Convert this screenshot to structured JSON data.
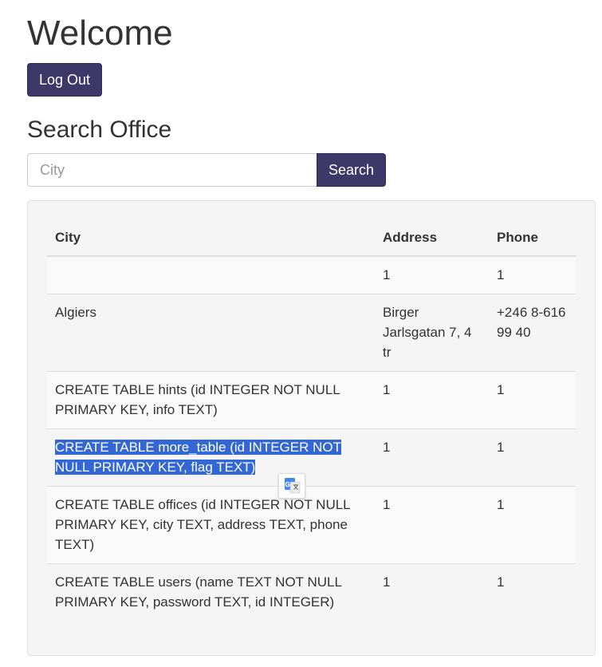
{
  "header": {
    "title": "Welcome",
    "logout_label": "Log Out"
  },
  "search": {
    "heading": "Search Office",
    "placeholder": "City",
    "value": "",
    "button_label": "Search"
  },
  "table": {
    "columns": [
      "City",
      "Address",
      "Phone"
    ],
    "rows": [
      {
        "city": "",
        "address": "1",
        "phone": "1"
      },
      {
        "city": "Algiers",
        "address": "Birger Jarlsgatan 7, 4 tr",
        "phone": "+246 8-616 99 40"
      },
      {
        "city": "CREATE TABLE hints (id INTEGER NOT NULL PRIMARY KEY, info TEXT)",
        "address": "1",
        "phone": "1"
      },
      {
        "city": "CREATE TABLE more_table (id INTEGER NOT NULL PRIMARY KEY, flag TEXT)",
        "address": "1",
        "phone": "1"
      },
      {
        "city": "CREATE TABLE offices (id INTEGER NOT NULL PRIMARY KEY, city TEXT, address TEXT, phone TEXT)",
        "address": "1",
        "phone": "1"
      },
      {
        "city": "CREATE TABLE users (name TEXT NOT NULL PRIMARY KEY, password TEXT, id INTEGER)",
        "address": "1",
        "phone": "1"
      }
    ]
  },
  "overlay": {
    "translate_icon": "google-translate-icon"
  },
  "colors": {
    "primary": "#3d3867",
    "selection": "#3367d6",
    "panel_bg": "#f5f5f5"
  }
}
